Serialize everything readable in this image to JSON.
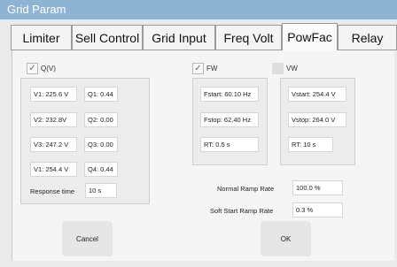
{
  "window": {
    "title": "Grid Param"
  },
  "tabs": [
    "Limiter",
    "Sell Control",
    "Grid Input",
    "Freq Volt",
    "PowFac",
    "Relay"
  ],
  "qv": {
    "label": "Q(V)",
    "checked": true,
    "check_glyph": "✓",
    "v1a": "V1: 225.6 V",
    "q1": "Q1: 0.44",
    "v2": "V2: 232.8V",
    "q2": "Q2: 0.00",
    "v3": "V3: 247.2 V",
    "q3": "Q3: 0.00",
    "v1b": "V1: 254.4 V",
    "q4": "Q4: 0.44",
    "response_label": "Response time",
    "response_value": "10 s"
  },
  "fw": {
    "label": "FW",
    "checked": true,
    "check_glyph": "✓",
    "fstart": "Fstart: 60.10 Hz",
    "fstop": "Fstop: 62.40 Hz",
    "rt": "RT: 0.5 s"
  },
  "vw": {
    "label": "VW",
    "checked": false,
    "vstart": "Vstart: 254.4 V",
    "vstop": "Vstop: 264.0 V",
    "rt": "RT: 10 s"
  },
  "ramp": {
    "normal_label": "Normal Ramp Rate",
    "normal_value": "100.0 %",
    "soft_label": "Soft Start Ramp Rate",
    "soft_value": "0.3 %"
  },
  "buttons": {
    "cancel": "Cancel",
    "ok": "OK"
  },
  "colors": {
    "titlebar": "#8fb3d3",
    "background": "#eaeaea",
    "panel": "#ececec"
  }
}
